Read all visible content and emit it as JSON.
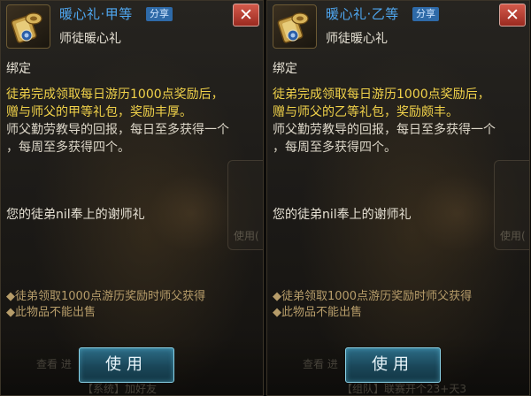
{
  "panels": [
    {
      "title": "暖心礼·甲等",
      "share_label": "分享",
      "subtitle": "师徒暖心礼",
      "close_symbol": "✕",
      "bind_label": "绑定",
      "desc_gold": [
        "徒弟完成领取每日游历1000点奖励后，",
        "赠与师父的甲等礼包，奖励丰厚。"
      ],
      "desc_white": [
        "师父勤劳教导的回报，每日至多获得一个",
        "，每周至多获得四个。"
      ],
      "thanks_text": "您的徒弟nil奉上的谢师礼",
      "notes": [
        "◆徒弟领取1000点游历奖励时师父获得",
        "◆此物品不能出售"
      ],
      "use_label": "使用",
      "bg_button_label": "使用(",
      "bg_bottom_text": "查看  进",
      "bg_bottom_text2": "【系统】加好友"
    },
    {
      "title": "暖心礼·乙等",
      "share_label": "分享",
      "subtitle": "师徒暖心礼",
      "close_symbol": "✕",
      "bind_label": "绑定",
      "desc_gold": [
        "徒弟完成领取每日游历1000点奖励后，",
        "赠与师父的乙等礼包，奖励颇丰。"
      ],
      "desc_white": [
        "师父勤劳教导的回报，每日至多获得一个",
        "，每周至多获得四个。"
      ],
      "thanks_text": "您的徒弟nil奉上的谢师礼",
      "notes": [
        "◆徒弟领取1000点游历奖励时师父获得",
        "◆此物品不能出售"
      ],
      "use_label": "使用",
      "bg_button_label": "使用(",
      "bg_bottom_text": "查看  进",
      "bg_bottom_text2": "【组队】联赛开个23+天3"
    }
  ],
  "colors": {
    "title": "#4fa7f0",
    "gold_text": "#f1d24a",
    "note_text": "#b79d6a",
    "close_bg": "#c0463a",
    "use_button": "#1f5a70"
  },
  "icons": {
    "item_icon": "gift-scroll-icon",
    "close_icon": "close-icon"
  }
}
